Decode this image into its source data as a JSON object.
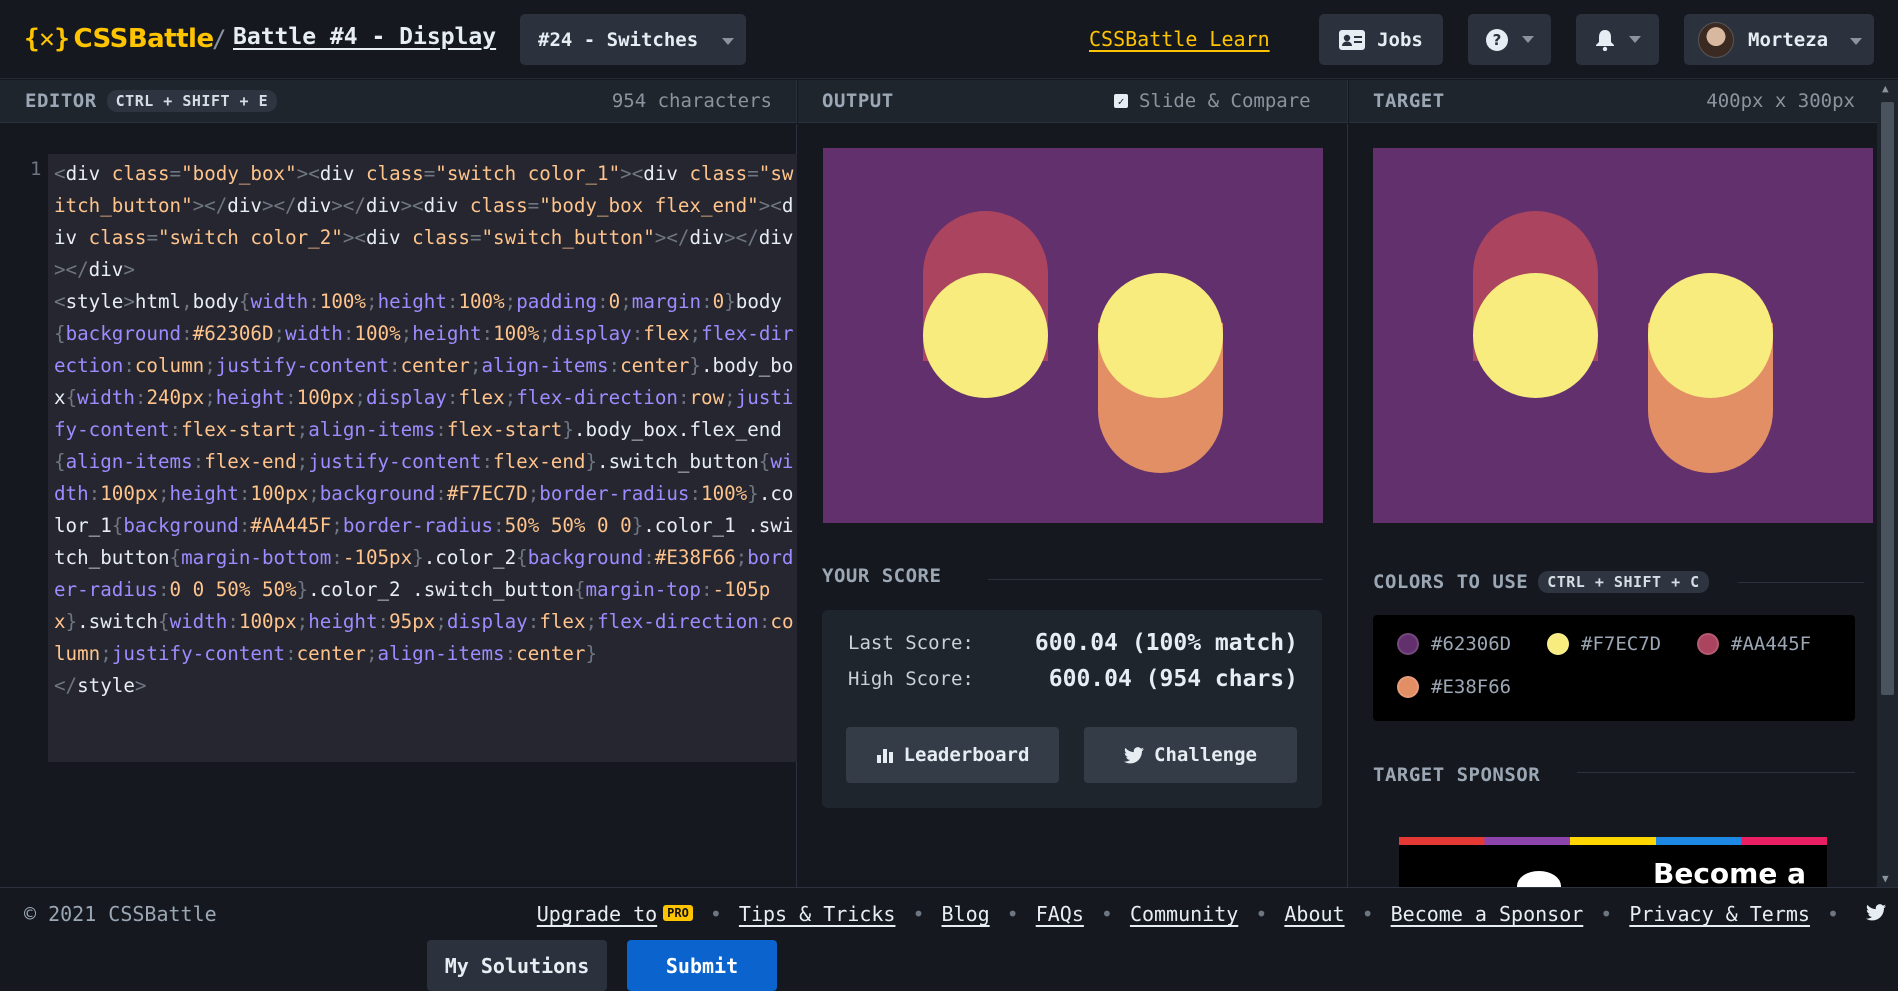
{
  "header": {
    "logo_text": "CSSBattle",
    "logo_mark": "{✕}",
    "crumb_sep": "/",
    "battle_title": "Battle #4 - Display",
    "target_select": "#24 - Switches",
    "learn_link": "CSSBattle Learn",
    "jobs_label": "Jobs",
    "help_icon": "question-icon",
    "notif_icon": "bell-icon",
    "username": "Morteza"
  },
  "editor": {
    "title": "EDITOR",
    "shortcut": "CTRL + SHIFT + E",
    "char_count": "954 characters",
    "line_number": "1",
    "my_solutions": "My Solutions",
    "submit": "Submit"
  },
  "output": {
    "title": "OUTPUT",
    "compare_label": "Slide & Compare",
    "compare_checked": true
  },
  "target": {
    "title": "TARGET",
    "size": "400px x 300px"
  },
  "score": {
    "title": "YOUR SCORE",
    "last_label": "Last Score:",
    "last_value": "600.04 (100% match)",
    "high_label": "High Score:",
    "high_value": "600.04 (954 chars)",
    "leaderboard": "Leaderboard",
    "challenge": "Challenge"
  },
  "colors": {
    "title": "COLORS TO USE",
    "shortcut": "CTRL + SHIFT + C",
    "list": [
      "#62306D",
      "#F7EC7D",
      "#AA445F",
      "#E38F66"
    ]
  },
  "sponsor": {
    "title": "TARGET SPONSOR",
    "banner_text": "Become a"
  },
  "footer": {
    "copyright": "© 2021 CSSBattle",
    "upgrade": "Upgrade to",
    "pro_badge": "PRO",
    "links": [
      "Tips & Tricks",
      "Blog",
      "FAQs",
      "Community",
      "About",
      "Become a Sponsor",
      "Privacy & Terms"
    ]
  }
}
